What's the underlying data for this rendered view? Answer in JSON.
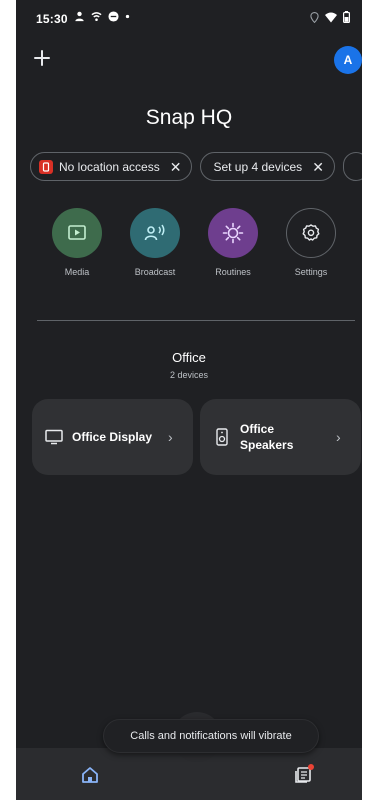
{
  "status_bar": {
    "time": "15:30",
    "left_icons": [
      "person-icon",
      "wifi-calling-icon",
      "messaging-icon",
      "dot-icon"
    ],
    "right_icons": [
      "location-icon",
      "wifi-icon",
      "battery-icon"
    ]
  },
  "header": {
    "add_icon": "plus-icon",
    "avatar_initial": "A",
    "avatar_color": "#1a73e8",
    "home_name": "Snap HQ"
  },
  "chips": [
    {
      "label": "No location access",
      "icon": "location-off-icon",
      "icon_color": "#d93025"
    },
    {
      "label": "Set up 4 devices",
      "icon": null
    }
  ],
  "actions": [
    {
      "label": "Media",
      "icon": "media-icon",
      "color": "#3e6b4c"
    },
    {
      "label": "Broadcast",
      "icon": "broadcast-icon",
      "color": "#2f6b73"
    },
    {
      "label": "Routines",
      "icon": "routines-icon",
      "color": "#6e3e8e"
    },
    {
      "label": "Settings",
      "icon": "settings-icon",
      "color": "#1f2023"
    }
  ],
  "room": {
    "name": "Office",
    "device_count": "2 devices",
    "devices": [
      {
        "name": "Office Display",
        "icon": "display-icon"
      },
      {
        "name_line1": "Office",
        "name_line2": "Speakers",
        "icon": "speaker-icon"
      }
    ]
  },
  "toast": {
    "text": "Calls and notifications will vibrate"
  },
  "bottom_nav": {
    "items": [
      {
        "icon": "home-icon",
        "selected": true,
        "color": "#8ab4f8"
      },
      {
        "icon": "feed-icon",
        "badge": true,
        "badge_color": "#ea4335"
      }
    ]
  }
}
